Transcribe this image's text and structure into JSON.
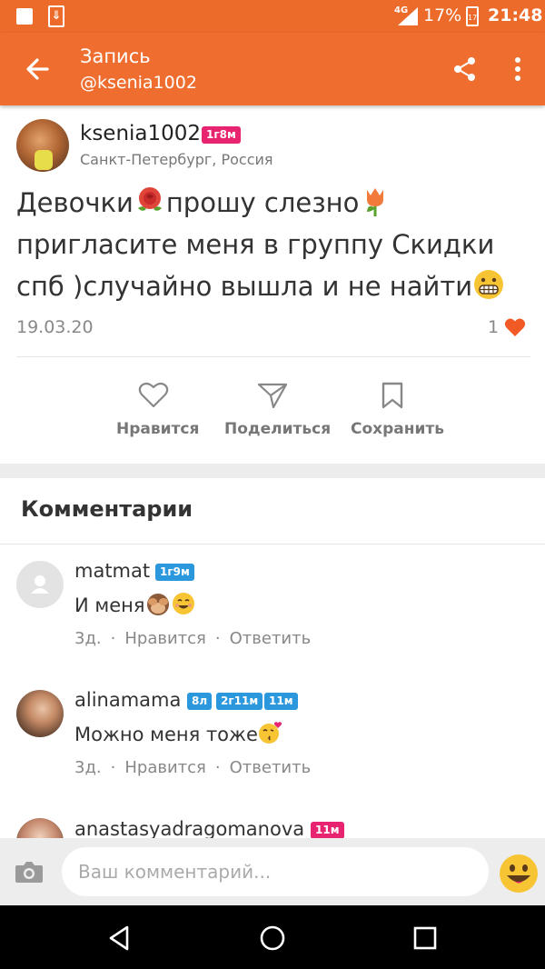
{
  "status_bar": {
    "network": "4G",
    "battery": "17%",
    "battery_icon_text": "17",
    "time": "21:48",
    "download_glyph": "⇓"
  },
  "app_bar": {
    "title": "Запись",
    "subtitle": "@ksenia1002",
    "icons": [
      "back-arrow-icon",
      "share-icon",
      "more-vertical-icon"
    ]
  },
  "post": {
    "author": "ksenia1002",
    "badge": "1г8м",
    "location": "Санкт-Петербург, Россия",
    "text_part1": "Девочки",
    "text_part2": "прошу слезно",
    "text_part3": "пригласите меня в группу Скидки спб )случайно вышла и не найти",
    "emojis": [
      "rose-emoji",
      "tulip-emoji",
      "grimacing-face-emoji"
    ],
    "date": "19.03.20",
    "likes": "1"
  },
  "actions": {
    "like": "Нравится",
    "share": "Поделиться",
    "save": "Сохранить"
  },
  "comments_title": "Комментарии",
  "comments": [
    {
      "name": "matmat",
      "badges": [
        "1г9м"
      ],
      "text": "И меня",
      "emojis": [
        "see-no-evil-monkey-emoji",
        "smiling-face-emoji"
      ],
      "time": "3д.",
      "like": "Нравится",
      "reply": "Ответить"
    },
    {
      "name": "alinamama",
      "badges": [
        "8л",
        "2г11м",
        "11м"
      ],
      "text": "Можно меня тоже",
      "emojis": [
        "kissing-heart-face-emoji"
      ],
      "time": "3д.",
      "like": "Нравится",
      "reply": "Ответить"
    },
    {
      "name": "anastasyadragomanova",
      "badges": [
        "11м"
      ]
    }
  ],
  "input": {
    "placeholder": "Ваш комментарий..."
  },
  "colors": {
    "brand": "#ee6d2f",
    "badge_pink": "#e8236f",
    "badge_blue": "#2b97dd",
    "heart": "#f15a24"
  }
}
